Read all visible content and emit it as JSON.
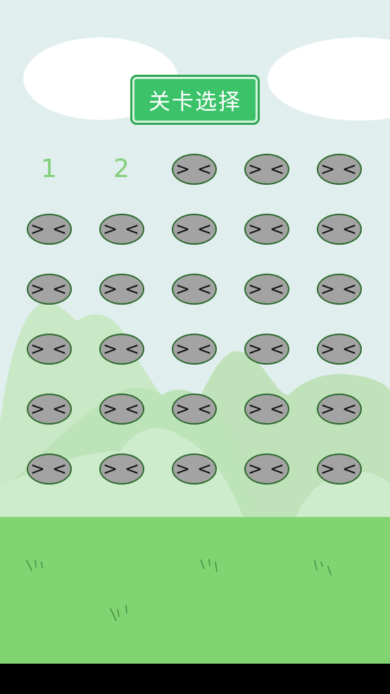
{
  "header": {
    "title": "关卡选择"
  },
  "levels": {
    "unlocked": [
      "1",
      "2"
    ],
    "locked_face": "> <",
    "locked_count": 28
  },
  "colors": {
    "sky": "#e0eeee",
    "cloud": "#ffffff",
    "title_button": "#3cc36a",
    "level_number": "#83cf78",
    "locked_level": "#a3a3a3",
    "grass": "#80d572",
    "hills": [
      "#c8e8c4",
      "#bde3b9",
      "#cdeccb"
    ]
  },
  "icons": {
    "locked_level": "squinting-face-icon"
  }
}
